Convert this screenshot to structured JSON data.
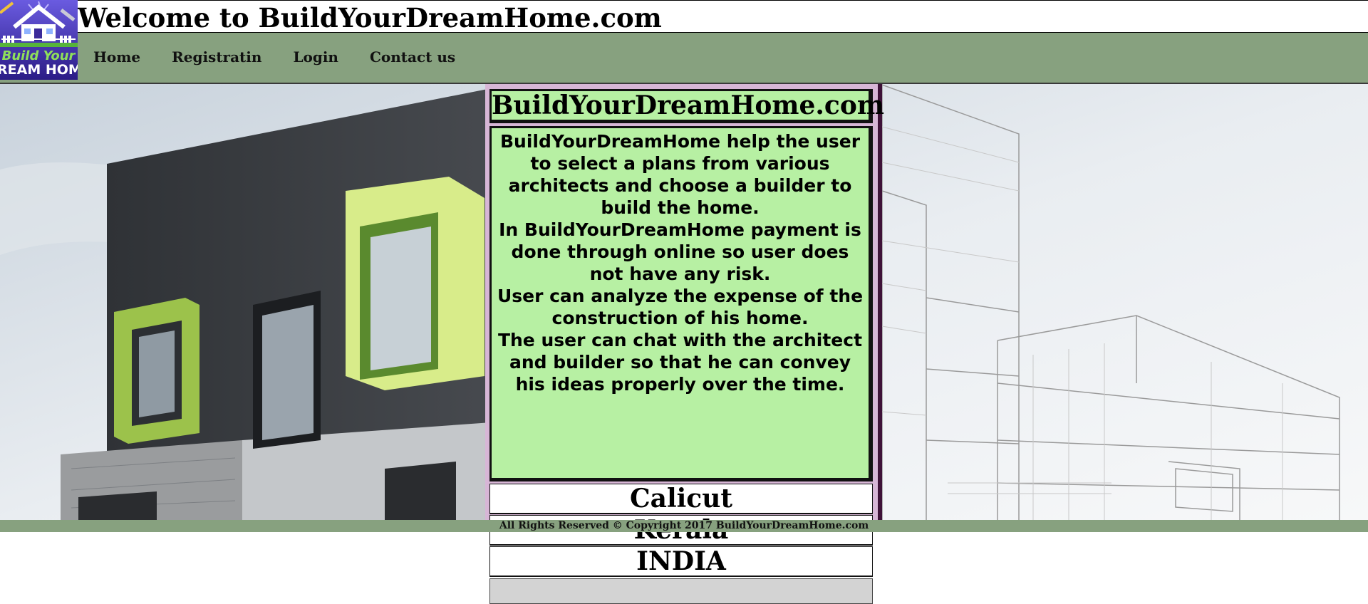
{
  "header": {
    "logo": {
      "line1": "Build Your",
      "line2": "DREAM HOME"
    },
    "title": "Welcome to BuildYourDreamHome.com"
  },
  "nav": {
    "items": [
      {
        "label": "Home"
      },
      {
        "label": "Registratin"
      },
      {
        "label": "Login"
      },
      {
        "label": "Contact us"
      }
    ]
  },
  "panel": {
    "title": "BuildYourDreamHome.com",
    "paragraphs": [
      "BuildYourDreamHome help the user to select a plans from various architects and choose a builder to build the home.",
      "In BuildYourDreamHome payment is done through online so user does not have any risk.",
      "User can analyze the expense of the construction of his home.",
      "The user can chat with the architect and builder so that he can convey his ideas properly over the time."
    ],
    "locations": [
      "Calicut",
      "Kerala",
      "INDIA"
    ]
  },
  "footer": {
    "text": "All Rights Reserved © Copyright 2017 BuildYourDreamHome.com"
  },
  "colors": {
    "nav_bg": "#87a17f",
    "panel_green": "#b7f0a3",
    "panel_border": "#3e1238",
    "logo_bg": "#3b2a9a"
  }
}
